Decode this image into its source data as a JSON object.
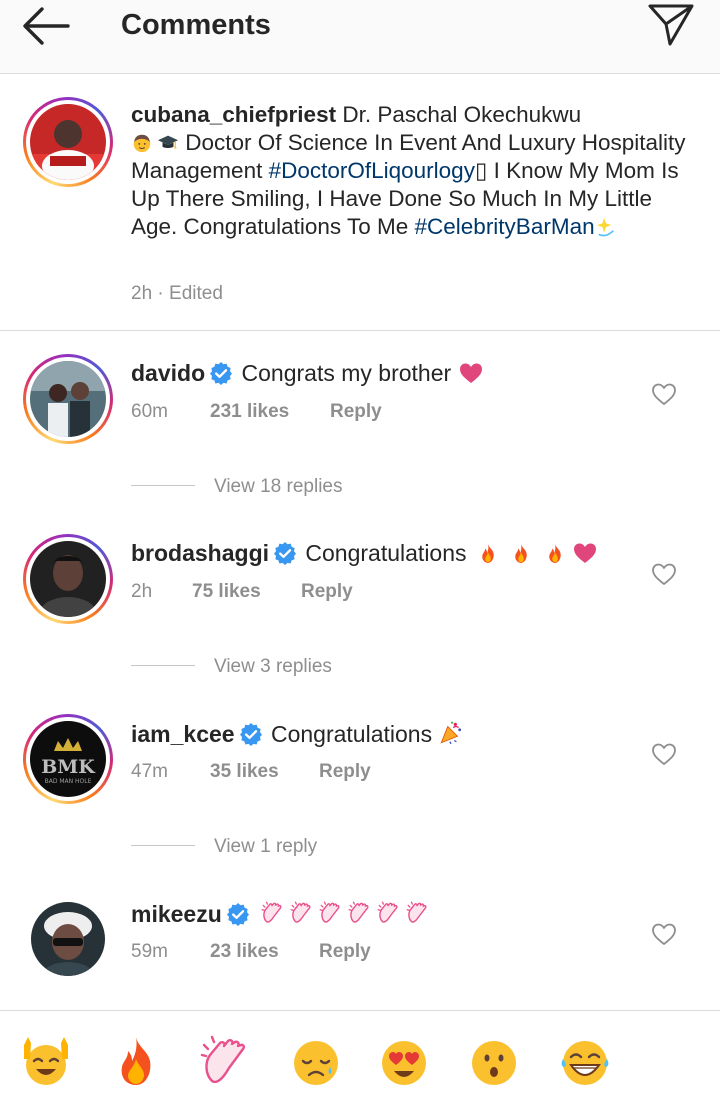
{
  "header": {
    "title": "Comments"
  },
  "post": {
    "username": "cubana_chiefpriest",
    "caption_part1": " Dr. Paschal Okechukwu ",
    "caption_part2": " Doctor Of Science In Event And Luxury Hospitality Management ",
    "hashtag1": "#DoctorOfLiqourlogy",
    "caption_part3": "▯ I Know My Mom Is Up There Smiling, I Have Done So Much In My Little Age. Congratulations To Me ",
    "hashtag2": "#CelebrityBarMan",
    "time": "2h",
    "edited": "· Edited"
  },
  "comments": [
    {
      "username": "davido",
      "text": "Congrats my brother",
      "time": "60m",
      "likes": "231 likes",
      "reply": "Reply",
      "view_replies": "View 18 replies"
    },
    {
      "username": "brodashaggi",
      "text": "Congratulations",
      "time": "2h",
      "likes": "75 likes",
      "reply": "Reply",
      "view_replies": "View 3 replies"
    },
    {
      "username": "iam_kcee",
      "text": "Congratulations",
      "time": "47m",
      "likes": "35 likes",
      "reply": "Reply",
      "view_replies": "View 1 reply"
    },
    {
      "username": "mikeezu",
      "text": "",
      "time": "59m",
      "likes": "23 likes",
      "reply": "Reply"
    }
  ],
  "kcee_logo_text": "BMK",
  "kcee_logo_sub": "BAD MAN HOLE",
  "emoji_bar": [
    "raising-hands-icon",
    "fire-icon",
    "clapping-hands-icon",
    "sad-face-icon",
    "heart-eyes-icon",
    "surprised-face-icon",
    "laughing-face-icon"
  ],
  "colors": {
    "hashtag": "#00376b",
    "verified": "#3897f0",
    "heart": "#e0467c",
    "meta": "#8e8e8e"
  }
}
